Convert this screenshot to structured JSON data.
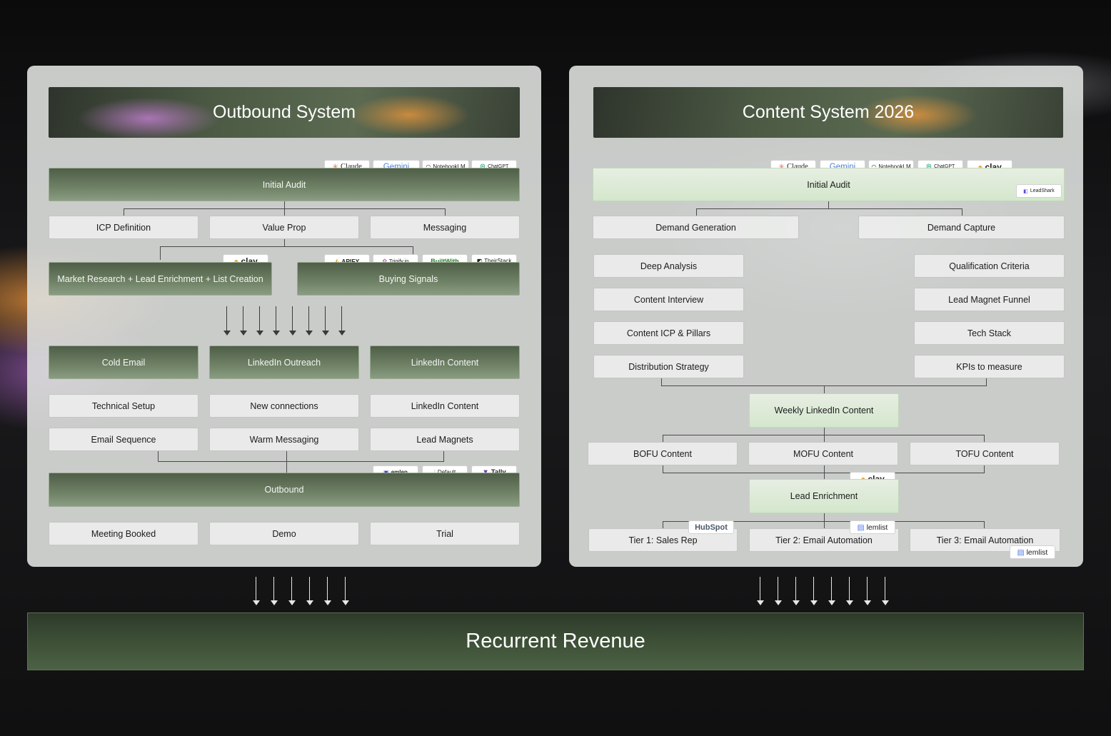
{
  "outbound": {
    "title": "Outbound System",
    "initial_audit": "Initial Audit",
    "audit_tools": [
      "Claude",
      "Gemini",
      "NotebookLM",
      "ChatGPT"
    ],
    "pillars": [
      "ICP Definition",
      "Value Prop",
      "Messaging"
    ],
    "research": "Market Research + Lead Enrichment + List Creation",
    "research_tool": "clay",
    "buying_signals": "Buying Signals",
    "signal_tools": [
      "APIFY",
      "Trigify.io",
      "BuiltWith",
      "TheirStack"
    ],
    "channels": [
      "Cold Email",
      "LinkedIn Outreach",
      "LinkedIn Content"
    ],
    "row1": [
      "Technical Setup",
      "New connections",
      "LinkedIn Content"
    ],
    "row2": [
      "Email Sequence",
      "Warm Messaging",
      "Lead Magnets"
    ],
    "outbound_label": "Outbound",
    "outbound_tools": [
      "emlen",
      "Default",
      "Tally"
    ],
    "outcomes": [
      "Meeting Booked",
      "Demo",
      "Trial"
    ]
  },
  "content": {
    "title": "Content System 2026",
    "initial_audit": "Initial Audit",
    "audit_tools": [
      "Claude",
      "Gemini",
      "NotebookLM",
      "ChatGPT",
      "clay"
    ],
    "audit_extra_tool": "LeadShark",
    "demand": [
      "Demand Generation",
      "Demand Capture"
    ],
    "left_list": [
      "Deep Analysis",
      "Content Interview",
      "Content ICP & Pillars",
      "Distribution Strategy"
    ],
    "right_list": [
      "Qualification Criteria",
      "Lead Magnet Funnel",
      "Tech Stack",
      "KPIs to measure"
    ],
    "weekly": "Weekly LinkedIn Content",
    "funnel": [
      "BOFU Content",
      "MOFU Content",
      "TOFU Content"
    ],
    "lead_enrichment": "Lead Enrichment",
    "enrichment_tool": "clay",
    "tiers": [
      "Tier 1: Sales Rep",
      "Tier 2: Email Automation",
      "Tier 3: Email Automation"
    ],
    "tier_tools": [
      "HubSpot",
      "lemlist",
      "lemlist"
    ]
  },
  "revenue": "Recurrent Revenue"
}
